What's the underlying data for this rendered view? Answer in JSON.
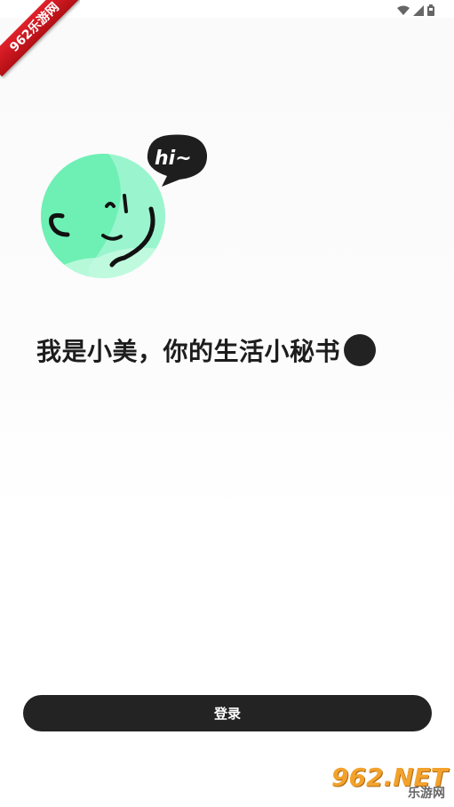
{
  "status_bar": {
    "icons": [
      "wifi-icon",
      "signal-icon",
      "battery-icon"
    ]
  },
  "ribbon": {
    "label": "962乐游网"
  },
  "avatar": {
    "bubble_text": "hi~"
  },
  "slogan": {
    "text": "我是小美，你的生活小秘书"
  },
  "login": {
    "label": "登录"
  },
  "watermark": {
    "brand": "962.NET",
    "sub": "乐游网"
  },
  "colors": {
    "accent_green": "#6ef0b4",
    "button_bg": "#232323",
    "text": "#1d1d1d"
  }
}
